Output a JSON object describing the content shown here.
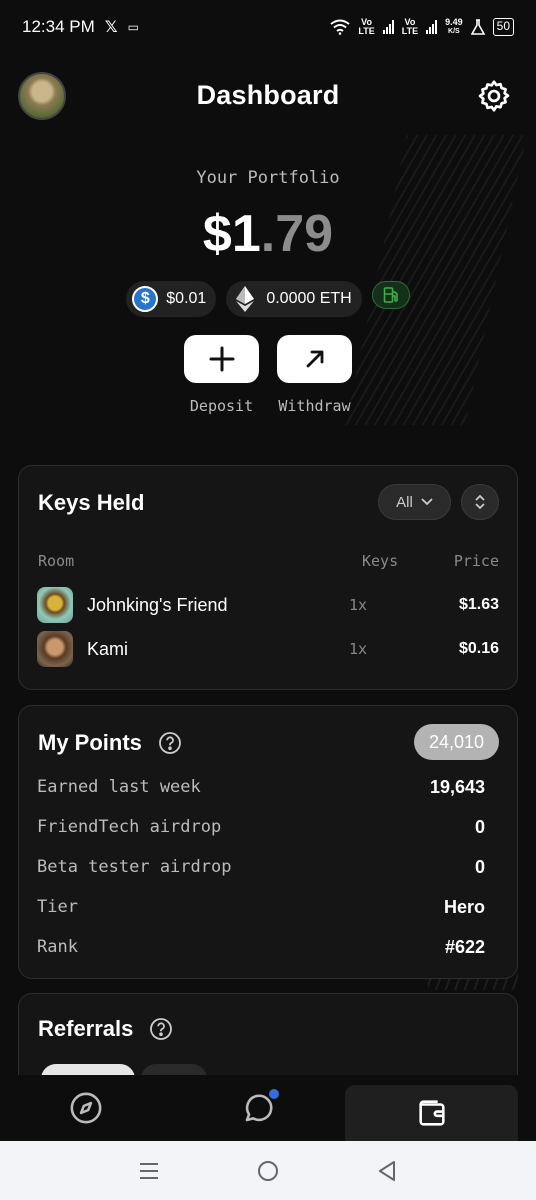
{
  "status_bar": {
    "time": "12:34 PM",
    "icons": [
      "x-logo-icon",
      "message-icon",
      "wifi-icon",
      "volte-icon",
      "signal-icon",
      "speed-icon",
      "flask-icon"
    ],
    "volte_1": "Vo\nLTE",
    "volte_2": "Vo\nLTE",
    "speed": "9.49",
    "speed_unit": "K/S",
    "battery": "50"
  },
  "header": {
    "title": "Dashboard",
    "avatar_icon": "profile-avatar",
    "settings_icon": "gear-icon"
  },
  "portfolio": {
    "label": "Your Portfolio",
    "value_whole": "$1",
    "value_decimal": ".79",
    "usdc_balance": "$0.01",
    "eth_balance": "0.0000 ETH",
    "deposit_label": "Deposit",
    "withdraw_label": "Withdraw"
  },
  "keys_held": {
    "title": "Keys Held",
    "filter_label": "All",
    "columns": {
      "room": "Room",
      "keys": "Keys",
      "price": "Price"
    },
    "rows": [
      {
        "name": "Johnking's Friend",
        "keys": "1x",
        "price": "$1.63"
      },
      {
        "name": "Kami",
        "keys": "1x",
        "price": "$0.16"
      }
    ]
  },
  "my_points": {
    "title": "My Points",
    "total": "24,010",
    "rows": [
      {
        "label": "Earned last week",
        "value": "19,643"
      },
      {
        "label": "FriendTech airdrop",
        "value": "0"
      },
      {
        "label": "Beta tester airdrop",
        "value": "0"
      },
      {
        "label": "Tier",
        "value": "Hero"
      },
      {
        "label": "Rank",
        "value": "#622"
      }
    ]
  },
  "referrals": {
    "title": "Referrals"
  },
  "bottom_nav": [
    "compass-icon",
    "chat-icon",
    "wallet-icon"
  ],
  "colors": {
    "background": "#0d0d0d",
    "card": "#151515",
    "usdc": "#2775ca",
    "gas_green": "#3fae4a",
    "notification": "#2f6fe0"
  }
}
